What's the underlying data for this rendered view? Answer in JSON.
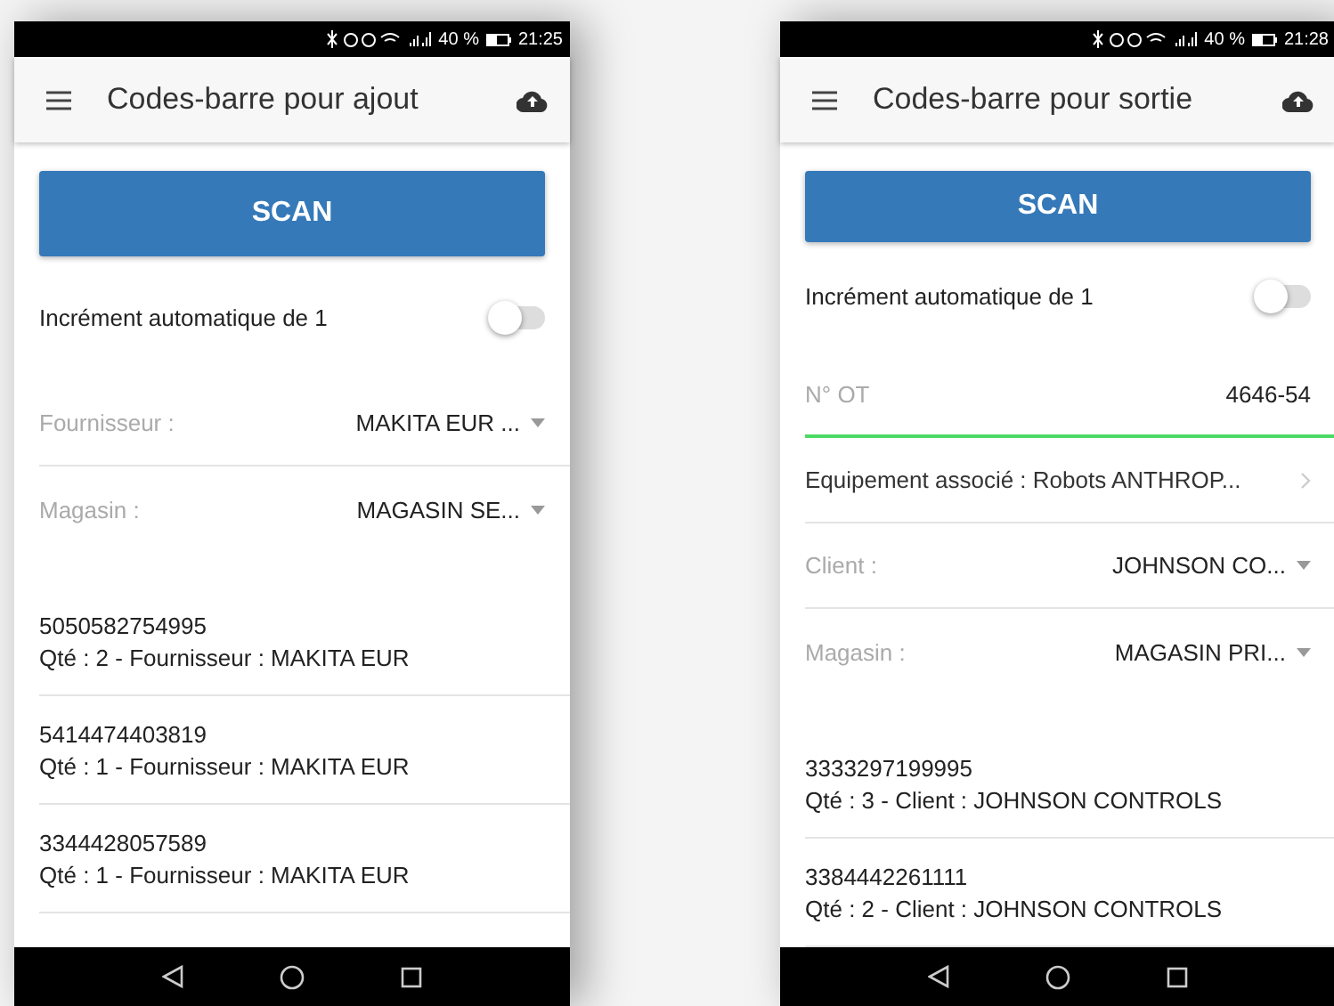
{
  "screens": [
    {
      "status_bar": {
        "battery": "40 %",
        "time": "21:25"
      },
      "title": "Codes-barre pour ajout",
      "scan_button": "SCAN",
      "toggle": {
        "label": "Incrément automatique de 1",
        "on": false
      },
      "fields": [
        {
          "kind": "select",
          "label": "Fournisseur :",
          "value": "MAKITA EUR ..."
        },
        {
          "kind": "select",
          "label": "Magasin :",
          "value": "MAGASIN SE..."
        }
      ],
      "items": [
        {
          "code": "5050582754995",
          "detail": "Qté : 2 - Fournisseur : MAKITA EUR"
        },
        {
          "code": "5414474403819",
          "detail": "Qté : 1 - Fournisseur : MAKITA EUR"
        },
        {
          "code": "3344428057589",
          "detail": "Qté : 1 - Fournisseur : MAKITA EUR"
        }
      ]
    },
    {
      "status_bar": {
        "battery": "40 %",
        "time": "21:28"
      },
      "title": "Codes-barre pour sortie",
      "scan_button": "SCAN",
      "toggle": {
        "label": "Incrément automatique de 1",
        "on": false
      },
      "fields": [
        {
          "kind": "input",
          "label": "N° OT",
          "value": "4646-54",
          "focused": true
        },
        {
          "kind": "link",
          "label": "Equipement associé : Robots ANTHROP..."
        },
        {
          "kind": "select",
          "label": "Client :",
          "value": "JOHNSON CO..."
        },
        {
          "kind": "select",
          "label": "Magasin :",
          "value": "MAGASIN PRI..."
        }
      ],
      "items": [
        {
          "code": "3333297199995",
          "detail": "Qté : 3 - Client : JOHNSON CONTROLS"
        },
        {
          "code": "3384442261111",
          "detail": "Qté : 2 - Client : JOHNSON CONTROLS"
        }
      ]
    }
  ]
}
